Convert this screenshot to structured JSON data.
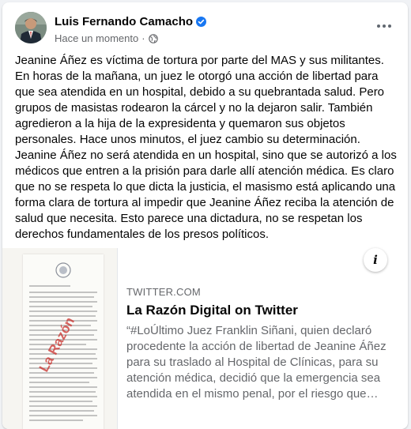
{
  "post": {
    "author_name": "Luis Fernando Camacho",
    "timestamp": "Hace un momento",
    "separator": "·",
    "privacy_icon": "globe-icon",
    "verified_icon": "verified-badge-icon",
    "more_icon": "more-options-icon",
    "body": "Jeanine Áñez es víctima de tortura por parte del MAS y sus militantes.\nEn horas de la mañana, un juez le otorgó una acción de libertad para que sea atendida en un hospital, debido a su quebrantada salud. Pero grupos de masistas rodearon la cárcel y no la dejaron salir. También agredieron a la hija de la expresidenta y quemaron sus objetos personales. Hace unos minutos, el juez cambio su determinación.\nJeanine Áñez no será atendida en un hospital, sino que se autorizó a los médicos que entren a la prisión para darle allí atención médica. Es claro que no se respeta lo que dicta la justicia, el masismo está aplicando una forma clara de tortura al impedir que Jeanine Áñez reciba la atención de salud que necesita. Esto parece una dictadura, no se respetan los derechos fundamentales de los presos políticos."
  },
  "link_preview": {
    "domain": "TWITTER.COM",
    "title": "La Razón Digital on Twitter",
    "description": "“#LoÚltimo Juez Franklin Siñani, quien declaró procedente la acción de libertad de Jeanine Áñez para su traslado al Hospital de Clínicas, para su atención médica, decidió que la emergencia sea atendida en el mismo penal, por el riesgo que…",
    "info_label": "i",
    "thumbnail_watermark": "La Razón"
  },
  "colors": {
    "verified_blue": "#1877f2",
    "secondary_text": "#65676b",
    "watermark_red": "#c9302c"
  }
}
